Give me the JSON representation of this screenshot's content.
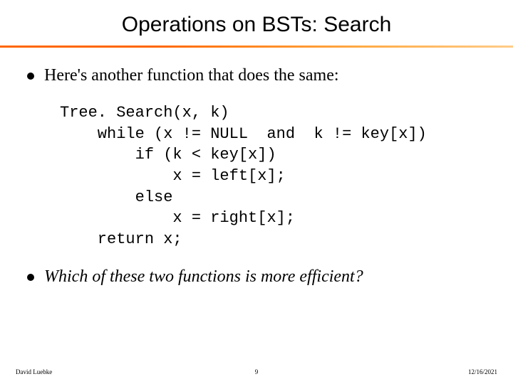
{
  "title": "Operations on BSTs: Search",
  "bullet1": "Here's another function that does the same:",
  "code": "Tree. Search(x, k)\n    while (x != NULL  and  k != key[x])\n        if (k < key[x])\n            x = left[x];\n        else\n            x = right[x];\n    return x;",
  "bullet2": "Which of these two functions is more efficient?",
  "footer": {
    "left": "David Luebke",
    "center": "9",
    "right": "12/16/2021"
  }
}
